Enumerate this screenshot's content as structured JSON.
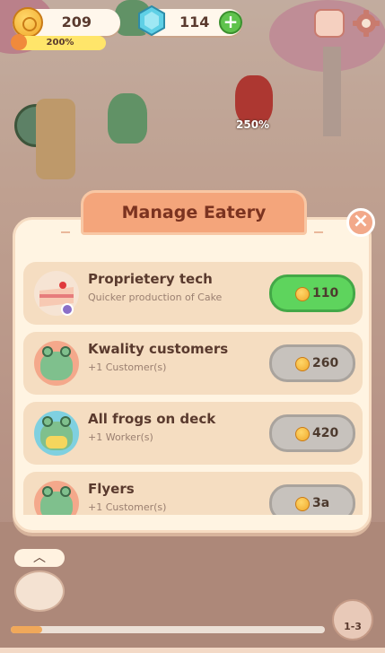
{
  "hud": {
    "coins": "209",
    "multiplier": "200%",
    "gems": "114",
    "frog_badge": "250%"
  },
  "modal": {
    "title": "Manage Eatery",
    "rows": [
      {
        "title": "Proprietery tech",
        "subtitle": "Quicker production of Cake",
        "price": "110",
        "state": "affordable"
      },
      {
        "title": "Kwality customers",
        "subtitle": "+1 Customer(s)",
        "price": "260",
        "state": "locked"
      },
      {
        "title": "All frogs on deck",
        "subtitle": "+1 Worker(s)",
        "price": "420",
        "state": "locked"
      },
      {
        "title": "Flyers",
        "subtitle": "+1 Customer(s)",
        "price": "3a",
        "state": "locked"
      }
    ]
  },
  "bottom": {
    "map_label": "1-3",
    "progress": 0.1
  },
  "colors": {
    "accent": "#f4a57b",
    "buy_green": "#5ed45d",
    "buy_grey": "#c7c2bd"
  }
}
